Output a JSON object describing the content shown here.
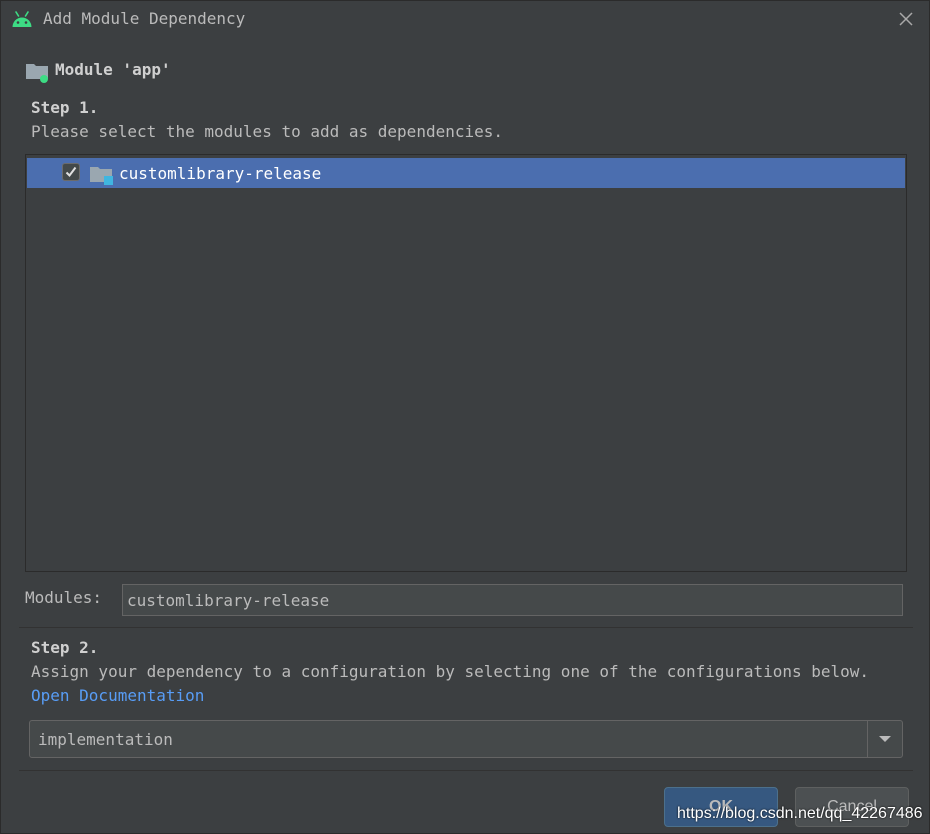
{
  "window": {
    "title": "Add Module Dependency",
    "icon": "android-icon",
    "close_icon": "close-icon"
  },
  "module_header": {
    "label": "Module 'app'",
    "icon": "module-folder-icon"
  },
  "step1": {
    "title": "Step 1.",
    "description": "Please select the modules to add as dependencies."
  },
  "module_list": {
    "items": [
      {
        "label": "customlibrary-release",
        "checked": true,
        "selected": true,
        "icon": "library-folder-icon"
      }
    ]
  },
  "modules_field": {
    "label": "Modules:",
    "value": "customlibrary-release"
  },
  "step2": {
    "title": "Step 2.",
    "description": "Assign your dependency to a configuration by selecting one of the configurations below.",
    "link": "Open Documentation"
  },
  "configuration": {
    "selected": "implementation"
  },
  "buttons": {
    "ok": "OK",
    "cancel": "Cancel"
  },
  "watermark": "https://blog.csdn.net/qq_42267486",
  "colors": {
    "background": "#3c3f41",
    "selection": "#4b6eaf",
    "link": "#589df6",
    "android_green": "#3ddc84",
    "ok_button": "#365880"
  }
}
